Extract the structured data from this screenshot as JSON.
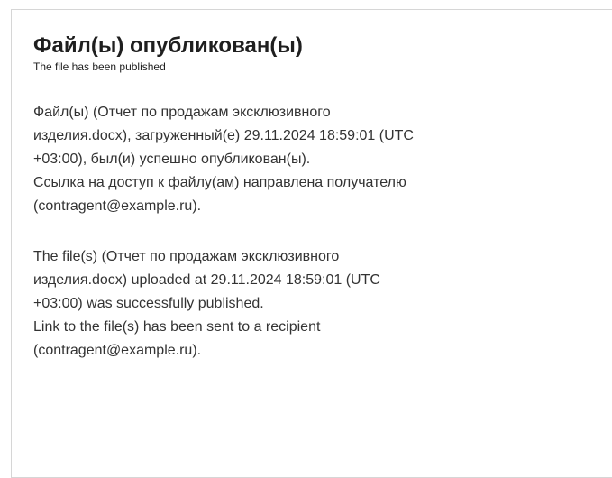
{
  "message": {
    "title": "Файл(ы) опубликован(ы)",
    "subtitle": "The file has been published",
    "ru_lines": [
      "Файл(ы) (Отчет по продажам эксклюзивного",
      "изделия.docx), загруженный(е) 29.11.2024 18:59:01 (UTC",
      "+03:00), был(и) успешно опубликован(ы).",
      "Ссылка на доступ к файлу(ам) направлена получателю",
      "(contragent@example.ru)."
    ],
    "en_lines": [
      "The file(s) (Отчет по продажам эксклюзивного",
      "изделия.docx) uploaded at 29.11.2024 18:59:01 (UTC",
      "+03:00) was successfully published.",
      "Link to the file(s) has been sent to a recipient",
      "(contragent@example.ru)."
    ]
  }
}
